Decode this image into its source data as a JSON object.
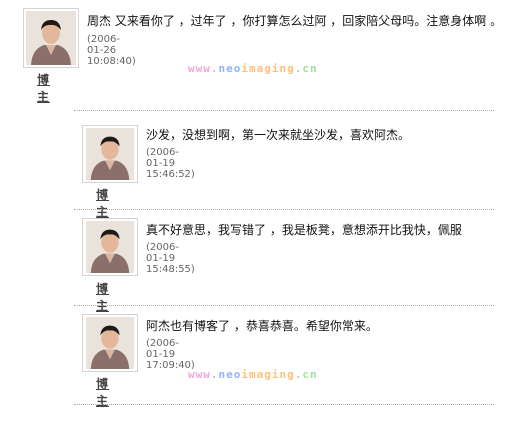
{
  "comments": [
    {
      "author": "博主",
      "text": "周杰  又来看你了  ，过年了 ，你打算怎么过阿  ，回家陪父母吗。注意身体啊  。",
      "time": "(2006-01-26 10:08:40)"
    },
    {
      "author": "博主",
      "text": "沙发，没想到啊，第一次来就坐沙发，喜欢阿杰。",
      "time": "(2006-01-19 15:46:52)"
    },
    {
      "author": "博主",
      "text": "真不好意思，我写错了  ，我是板凳，意想添开比我快，佩服",
      "time": "(2006-01-19 15:48:55)"
    },
    {
      "author": "博主",
      "text": "阿杰也有博客了  ，恭喜恭喜。希望你常来。",
      "time": "(2006-01-19 17:09:40)"
    }
  ],
  "watermark": {
    "part1": "www.",
    "part2": "neo",
    "part3": "imaging",
    "part4": ".cn"
  }
}
